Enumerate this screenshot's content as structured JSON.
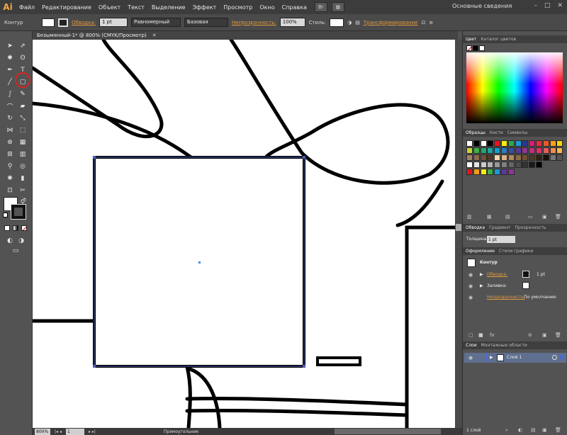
{
  "app": {
    "logo": "Ai",
    "workspace": "Основные сведения"
  },
  "menu": [
    "Файл",
    "Редактирование",
    "Объект",
    "Текст",
    "Выделение",
    "Эффект",
    "Просмотр",
    "Окно",
    "Справка"
  ],
  "window_controls": [
    "–",
    "□",
    "✕"
  ],
  "controlbar": {
    "mode": "Контур",
    "stroke_label": "Обводка:",
    "stroke_weight": "1 pt",
    "profile": "Равномерный",
    "brush": "Базовая",
    "opacity_label": "Непрозрачность:",
    "opacity": "100%",
    "styles_label": "Стиль:",
    "transform_label": "Трансформирование"
  },
  "document": {
    "tab_title": "Безымянный-1* @ 800% (CMYK/Просмотр)"
  },
  "statusbar": {
    "zoom": "800%",
    "artboard": "1",
    "tool": "Прямоугольник"
  },
  "panels": {
    "color": {
      "tabs": [
        "Цвет",
        "Каталог цветов"
      ]
    },
    "swatches": {
      "tabs": [
        "Образцы",
        "Кисти",
        "Символы"
      ],
      "rows": [
        [
          "#ffffff",
          "#000000",
          "#ffffff",
          "#000000",
          "#e8141a",
          "#f7ec13",
          "#2ba84a",
          "#1d9ad6",
          "#2b3791",
          "#d51b7f",
          "#e1303c",
          "#e95a28",
          "#f7a21b",
          "#fbd400"
        ],
        [
          "#c8d62b",
          "#3db049",
          "#1fa86f",
          "#1aa5a0",
          "#159ccf",
          "#2a7ec0",
          "#3a4fa0",
          "#5a3a97",
          "#8e3793",
          "#c0307e",
          "#e0306a",
          "#e65b5b",
          "#f08d4a",
          "#f6b949"
        ],
        [
          "#a0826d",
          "#8a6b4f",
          "#6e5238",
          "#4c3a28",
          "#f5d6b0",
          "#d8b48a",
          "#b38a5e",
          "#8e6a46",
          "#6e5236",
          "#4e3824",
          "#2e2216",
          "#161008",
          "#777777",
          "#555555"
        ],
        [
          "#ffffff",
          "#e6e6e6",
          "#cccccc",
          "#b3b3b3",
          "#999999",
          "#808080",
          "#666666",
          "#4d4d4d",
          "#333333",
          "#1a1a1a",
          "#000000"
        ],
        [
          "#e8141a",
          "#f39a1c",
          "#f7ec13",
          "#3db049",
          "#1d9ad6",
          "#5a3a97",
          "#8e3793"
        ]
      ]
    },
    "stroke": {
      "tabs": [
        "Обводка",
        "Градиент",
        "Прозрачность"
      ],
      "weight_label": "Толщина:",
      "weight": "1 pt"
    },
    "appearance": {
      "tabs": [
        "Оформление",
        "Стили графики"
      ],
      "object": "Контур",
      "stroke_label": "Обводка:",
      "stroke_value": "1 pt",
      "fill_label": "Заливка:",
      "opacity_label": "Непрозрачность:",
      "opacity_value": "По умолчанию"
    },
    "layers": {
      "tabs": [
        "Слои",
        "Монтажные области"
      ],
      "layer_name": "Слой 1",
      "footer": "1 слой"
    }
  }
}
